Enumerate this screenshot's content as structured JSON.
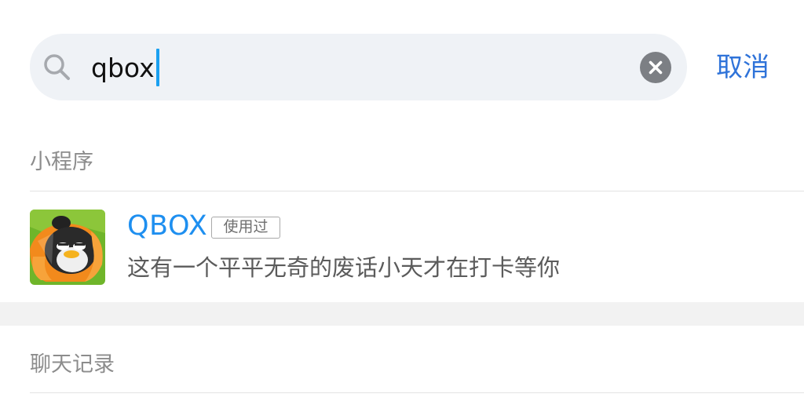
{
  "search": {
    "query": "qbox",
    "icon": "search-icon",
    "clear_icon": "close-icon",
    "cancel_label": "取消"
  },
  "sections": {
    "mini_programs": {
      "title": "小程序",
      "items": [
        {
          "name": "QBOX",
          "badge": "使用过",
          "description": "这有一个平平无奇的废话小天才在打卡等你",
          "icon": "qbox-app-icon"
        }
      ]
    },
    "chat_history": {
      "title": "聊天记录"
    }
  },
  "colors": {
    "accent": "#2f73d9",
    "app_name": "#1e8ff0",
    "search_bg": "#eff2f6",
    "caret": "#1aa0f0"
  }
}
